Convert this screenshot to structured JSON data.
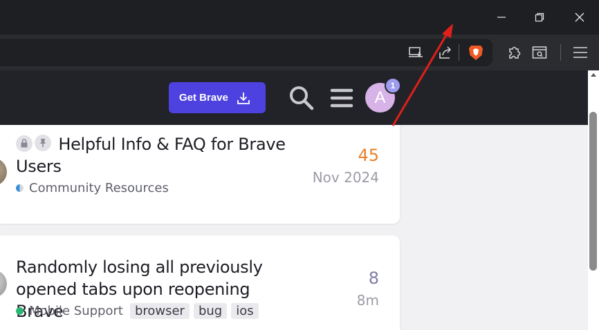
{
  "window": {
    "controls": [
      "minimize-icon",
      "restore-icon",
      "close-icon"
    ]
  },
  "toolbar": {
    "icons": [
      "cast-icon",
      "share-icon",
      "brave-shields-icon",
      "extensions-icon",
      "wallet-icon",
      "menu-icon"
    ]
  },
  "header": {
    "get_brave_label": "Get Brave",
    "avatar_letter": "A",
    "notification_count": "1"
  },
  "topics": [
    {
      "title": "Helpful Info & FAQ for Brave Users",
      "pinned": true,
      "locked": true,
      "category": "Community Resources",
      "category_color": "#3a8fd6",
      "tags": [],
      "posts": "45",
      "posts_color": "#e8802a",
      "activity": "Nov 2024"
    },
    {
      "title": "Randomly losing all previously opened tabs upon reopening Brave",
      "category": "Mobile Support",
      "category_color": "#2bb673",
      "tags": [
        "browser",
        "bug",
        "ios"
      ],
      "posts": "8",
      "posts_color": "#7d7da8",
      "activity": "8m"
    }
  ],
  "colors": {
    "accent": "#4d42e0",
    "header_bg": "#222329",
    "annotation": "#e0201b"
  }
}
